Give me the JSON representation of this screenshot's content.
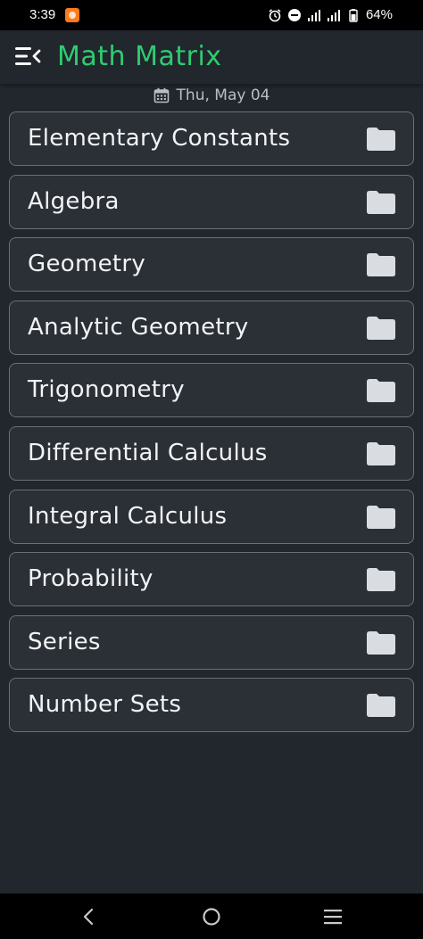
{
  "status_bar": {
    "time": "3:39",
    "battery": "64%"
  },
  "app_bar": {
    "title": "Math Matrix",
    "menu_icon": "menu-open-icon"
  },
  "date": {
    "text": "Thu, May 04",
    "icon": "calendar-icon"
  },
  "topics": [
    {
      "label": "Elementary Constants",
      "icon": "folder-icon"
    },
    {
      "label": "Algebra",
      "icon": "folder-icon"
    },
    {
      "label": "Geometry",
      "icon": "folder-icon"
    },
    {
      "label": "Analytic Geometry",
      "icon": "folder-icon"
    },
    {
      "label": "Trigonometry",
      "icon": "folder-icon"
    },
    {
      "label": "Differential Calculus",
      "icon": "folder-icon"
    },
    {
      "label": "Integral Calculus",
      "icon": "folder-icon"
    },
    {
      "label": "Probability",
      "icon": "folder-icon"
    },
    {
      "label": "Series",
      "icon": "folder-icon"
    },
    {
      "label": "Number Sets",
      "icon": "folder-icon"
    }
  ],
  "colors": {
    "background": "#22262d",
    "card": "#2b2f36",
    "card_border": "#6a7079",
    "accent": "#2ecc71",
    "folder": "#d9dde2"
  },
  "nav_bar": {
    "back_icon": "back-icon",
    "home_icon": "home-icon",
    "recents_icon": "recents-icon"
  }
}
